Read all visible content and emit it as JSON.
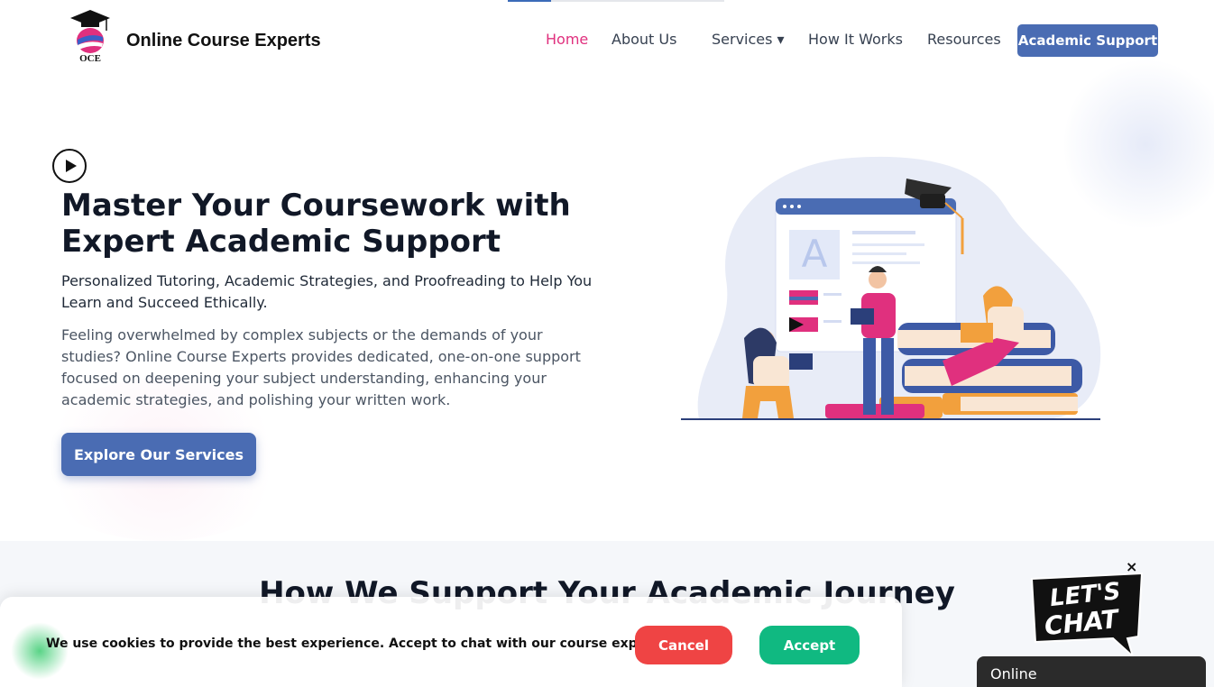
{
  "header": {
    "brand": "Online Course Experts",
    "logo_text": "OCE",
    "nav": [
      {
        "label": "Home"
      },
      {
        "label": "About Us"
      },
      {
        "label": "Services ▾"
      },
      {
        "label": "How It Works"
      },
      {
        "label": "Resources"
      }
    ],
    "cta": "Academic Support"
  },
  "hero": {
    "title_line1": "Master Your Coursework with",
    "title_line2": "Expert Academic Support",
    "subtitle": "Personalized Tutoring, Academic Strategies, and Proofreading to Help You Learn and Succeed Ethically.",
    "description": "Feeling overwhelmed by complex subjects or the demands of your studies? Online Course Experts provides dedicated, one-on-one support focused on deepening your subject understanding, enhancing your academic strategies, and polishing your written work.",
    "button": "Explore Our Services",
    "illustration_letter": "A"
  },
  "section2": {
    "title": "How We Support Your Academic Journey"
  },
  "cookie": {
    "text": "We use cookies to provide the best experience. Accept to chat with our course experts.",
    "cancel": "Cancel",
    "accept": "Accept"
  },
  "chat": {
    "close": "×",
    "bubble_line1": "LET'S",
    "bubble_line2": "CHAT",
    "status": "Online"
  },
  "colors": {
    "accent": "#4a6cb3",
    "active_nav": "#e0307e",
    "cancel": "#ef4444",
    "accept": "#10b981"
  }
}
